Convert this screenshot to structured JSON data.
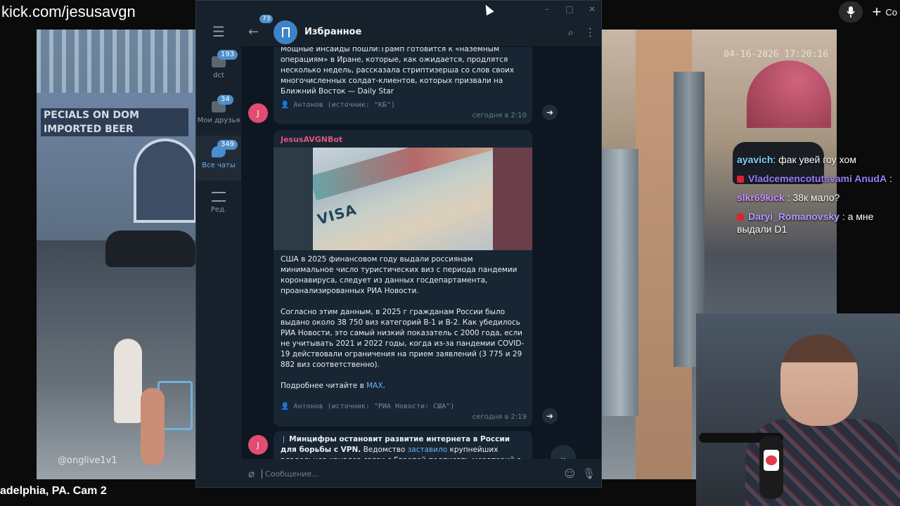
{
  "stream": {
    "url": "kick.com/jesusavgn",
    "new_label": "Со",
    "cam_caption": "adelphia, PA. Cam 2",
    "cam_timestamp": "04-16-2026 17:20:16",
    "cam_watermark": "@onglive1v1",
    "sign_text_1": "PECIALS ON DOM",
    "sign_text_2": "IMPORTED BEER"
  },
  "chat_overlay": [
    {
      "user": "ayavich",
      "message": "фак увей гоу хом",
      "color": "#7fd0ff"
    },
    {
      "user": "Vladcemencotutsvami AnudA",
      "message": "",
      "color": "#9b7cff"
    },
    {
      "user": "slkr69kick",
      "message": "38к мало?",
      "color": "#c792ff"
    },
    {
      "user": "Daryi_Romanovsky",
      "message": "а мне выдали D1",
      "color": "#b69bff"
    }
  ],
  "telegram": {
    "window_controls": [
      "–",
      "□",
      "✕"
    ],
    "sidebar": {
      "folders": [
        {
          "label": "dct",
          "badge": "193",
          "active": false
        },
        {
          "label": "Мои друзья",
          "badge": "34",
          "active": false
        },
        {
          "label": "Все чаты",
          "badge": "349",
          "active": true
        },
        {
          "label": "Ред.",
          "badge": "",
          "active": false
        }
      ]
    },
    "header": {
      "back_badge": "73",
      "title": "Избранное"
    },
    "messages": [
      {
        "text": "Мощные инсайды пошли:Трамп готовится к «наземным операциям» в Иране, которые, как ожидается, продлятся несколько недель, рассказала стриптизерша со слов своих многочисленных солдат-клиентов, которых призвали на Ближний Восток — Daily Star",
        "signature": "👤 Антонов (источник: \"КБ\")",
        "time": "сегодня в 2:10",
        "avatar": "J"
      },
      {
        "sender": "JesusAVGNBot",
        "photo_text": "VISA",
        "para1": "США в 2025 финансовом году выдали россиянам минимальное число туристических виз с периода пандемии коронавируса, следует из данных госдепартамента, проанализированных РИА Новости.",
        "para2": "Согласно этим данным, в 2025 г гражданам России было выдано около 38 750 виз категорий B-1 и B-2. Как убедилось РИА Новости, это самый низкий показатель с 2000 года, если не учитывать 2021 и 2022 годы, когда из-за пандемии COVID-19 действовали ограничения на прием заявлений (3 775 и 29 882 виз соответственно).",
        "more_prefix": "Подробнее читайте в ",
        "more_link": "MAX",
        "more_suffix": ".",
        "signature": "👤 Антонов (источник: \"РИА Новости: США\")",
        "time": "сегодня в 2:19"
      },
      {
        "title": "Минцифры остановит развитие интернета в России для борьбы с VPN.",
        "text_before_link": " Ведомство ",
        "link": "заставило",
        "text_after_link": " крупнейших владельцев каналов связи с Европой подписать мораторий о запрете на",
        "avatar": "J"
      }
    ],
    "composer": {
      "placeholder": "Сообщение..."
    }
  }
}
